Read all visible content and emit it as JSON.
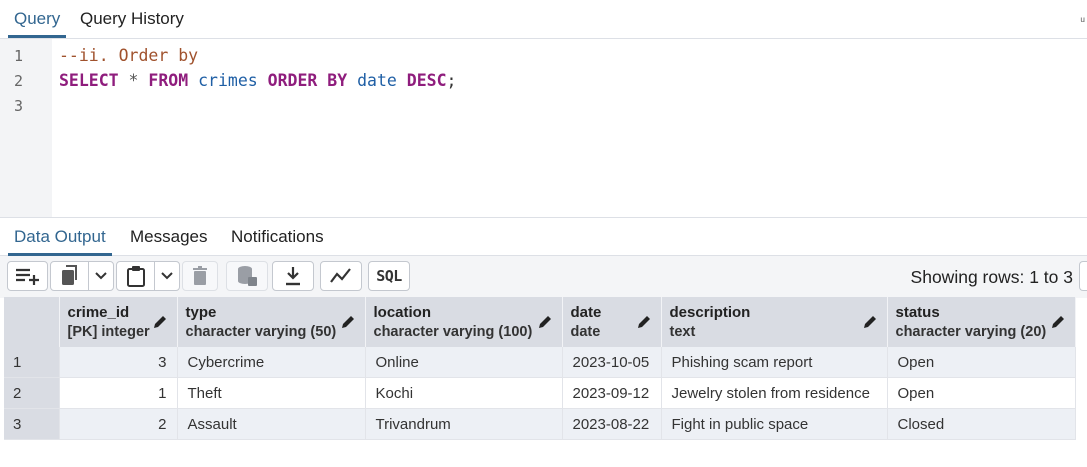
{
  "top_tabs": {
    "query": "Query",
    "history": "Query History"
  },
  "corner_mark": "ᵘ",
  "editor": {
    "line_numbers": [
      "1",
      "2",
      "3"
    ],
    "comment": "--ii. Order by",
    "tokens": {
      "select": "SELECT",
      "star": "*",
      "from": "FROM",
      "table": "crimes",
      "order_by": "ORDER BY",
      "column": "date",
      "desc": "DESC",
      "semicolon": ";"
    }
  },
  "bottom_tabs": {
    "data_output": "Data Output",
    "messages": "Messages",
    "notifications": "Notifications"
  },
  "toolbar": {
    "sql_label": "SQL",
    "rows_label": "Showing rows: 1 to 3"
  },
  "columns": [
    {
      "name": "crime_id",
      "type": "[PK] integer"
    },
    {
      "name": "type",
      "type": "character varying (50)"
    },
    {
      "name": "location",
      "type": "character varying (100)"
    },
    {
      "name": "date",
      "type": "date"
    },
    {
      "name": "description",
      "type": "text"
    },
    {
      "name": "status",
      "type": "character varying (20)"
    }
  ],
  "rows": [
    {
      "num": "1",
      "crime_id": "3",
      "type": "Cybercrime",
      "location": "Online",
      "date": "2023-10-05",
      "description": "Phishing scam report",
      "status": "Open"
    },
    {
      "num": "2",
      "crime_id": "1",
      "type": "Theft",
      "location": "Kochi",
      "date": "2023-09-12",
      "description": "Jewelry stolen from residence",
      "status": "Open"
    },
    {
      "num": "3",
      "crime_id": "2",
      "type": "Assault",
      "location": "Trivandrum",
      "date": "2023-08-22",
      "description": "Fight in public space",
      "status": "Closed"
    }
  ],
  "colors": {
    "accent": "#326690",
    "keyword": "#8f1d7d",
    "identifier": "#1f5fa5",
    "comment": "#a0522d",
    "header_bg": "#d9dce3"
  },
  "icons": [
    "add-row-icon",
    "copy-icon",
    "chevron-down-icon",
    "paste-icon",
    "delete-icon",
    "save-data-icon",
    "download-icon",
    "graph-icon",
    "sql-icon",
    "edit-pencil-icon"
  ]
}
